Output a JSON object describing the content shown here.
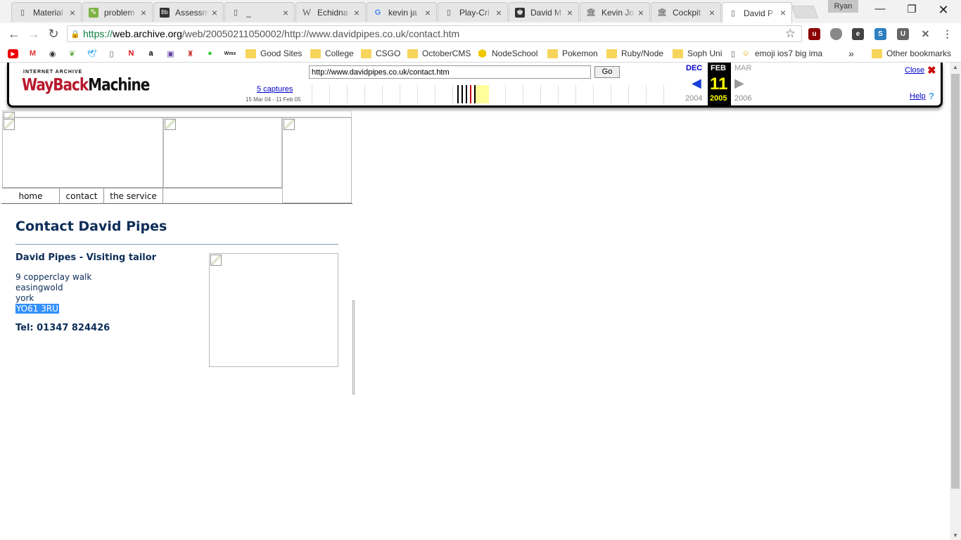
{
  "browser": {
    "tabs": [
      {
        "title": "Material",
        "icon": "page-icon",
        "active": false
      },
      {
        "title": "problem",
        "icon": "evernote-icon",
        "active": false
      },
      {
        "title": "Assessm",
        "icon": "blackboard-icon",
        "active": false
      },
      {
        "title": "_",
        "icon": "page-icon",
        "active": false
      },
      {
        "title": "Echidna",
        "icon": "wikipedia-icon",
        "active": false
      },
      {
        "title": "kevin ja",
        "icon": "google-icon",
        "active": false
      },
      {
        "title": "Play-Cri",
        "icon": "page-icon",
        "active": false
      },
      {
        "title": "David M",
        "icon": "crest-icon",
        "active": false
      },
      {
        "title": "Kevin Jo",
        "icon": "archive-icon",
        "active": false
      },
      {
        "title": "Cockpit",
        "icon": "archive-icon",
        "active": false
      },
      {
        "title": "David P",
        "icon": "page-icon",
        "active": true
      }
    ],
    "profile_name": "Ryan",
    "address": {
      "scheme": "https://",
      "host": "web.archive.org",
      "path": "/web/20050211050002/http://www.davidpipes.co.uk/contact.htm"
    },
    "bookmarks": [
      {
        "label": "",
        "icon": "youtube-icon"
      },
      {
        "label": "",
        "icon": "gmail-icon"
      },
      {
        "label": "",
        "icon": "reddit-icon"
      },
      {
        "label": "",
        "icon": "leaf-icon"
      },
      {
        "label": "",
        "icon": "twitter-icon"
      },
      {
        "label": "",
        "icon": "page-icon"
      },
      {
        "label": "",
        "icon": "netflix-icon"
      },
      {
        "label": "",
        "icon": "amazon-icon"
      },
      {
        "label": "",
        "icon": "twitch-icon"
      },
      {
        "label": "",
        "icon": "popcorn-icon"
      },
      {
        "label": "",
        "icon": "android-icon"
      },
      {
        "label": "",
        "icon": "wemx-icon"
      },
      {
        "label": "Good Sites",
        "icon": "folder-icon"
      },
      {
        "label": "College",
        "icon": "folder-icon"
      },
      {
        "label": "CSGO",
        "icon": "folder-icon"
      },
      {
        "label": "OctoberCMS",
        "icon": "folder-icon"
      },
      {
        "label": "NodeSchool",
        "icon": "hexagon-icon"
      },
      {
        "label": "Pokemon",
        "icon": "folder-icon"
      },
      {
        "label": "Ruby/Node",
        "icon": "folder-icon"
      },
      {
        "label": "Soph Uni",
        "icon": "folder-icon"
      },
      {
        "label": "emoji ios7 big ima",
        "icon": "emoji-icon"
      }
    ],
    "overflow_chevron": "»",
    "other_bookmarks": "Other bookmarks"
  },
  "wayback": {
    "logo_top": "INTERNET ARCHIVE",
    "logo_main_a": "WayBack",
    "logo_main_b": "Machine",
    "url_value": "http://www.davidpipes.co.uk/contact.htm",
    "go_label": "Go",
    "captures_label": "5 captures",
    "range_label": "15 Mar 04 - 11 Feb 05",
    "prev_month": "DEC",
    "prev_year": "2004",
    "cur_month": "FEB",
    "cur_day": "11",
    "cur_year": "2005",
    "next_month": "MAR",
    "next_year": "2006",
    "close_label": "Close",
    "help_label": "Help"
  },
  "site": {
    "nav": [
      "home",
      "contact",
      "the service"
    ],
    "heading": "Contact David Pipes",
    "name": "David Pipes - Visiting tailor",
    "address": [
      "9 copperclay walk",
      "easingwold",
      "york"
    ],
    "postcode": "YO61 3RU",
    "tel": "Tel: 01347 824426"
  },
  "colors": {
    "heading": "#0d2d58",
    "selection": "#3390ff",
    "wayback_red": "#b8192d"
  }
}
